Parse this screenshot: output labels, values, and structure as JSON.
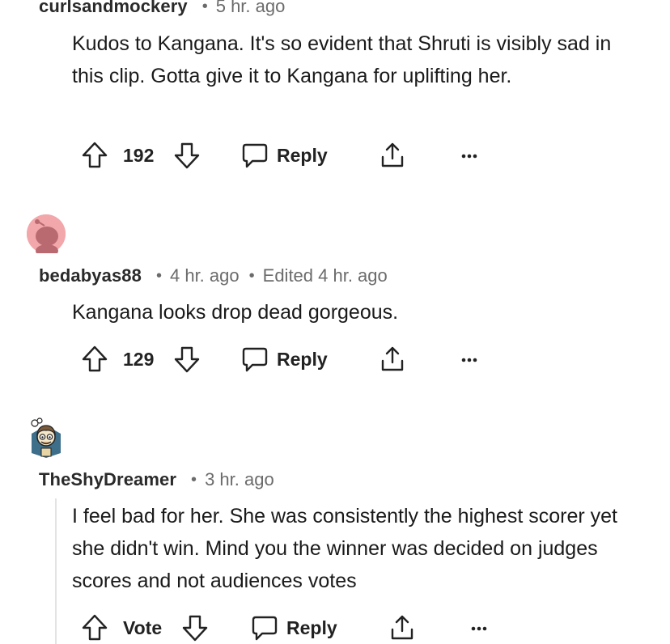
{
  "comments": [
    {
      "author": "curlsandmockery",
      "time": "5 hr. ago",
      "body": "Kudos to Kangana. It's so evident that Shruti is visibly sad in this clip. Gotta give it to Kangana for uplifting her.",
      "votes": "192",
      "reply_label": "Reply"
    },
    {
      "author": "bedabyas88",
      "time": "4 hr. ago",
      "edited": "Edited 4 hr. ago",
      "body": "Kangana looks drop dead gorgeous.",
      "votes": "129",
      "reply_label": "Reply"
    },
    {
      "author": "TheShyDreamer",
      "time": "3 hr. ago",
      "body": "I feel bad for her. She was consistently the highest scorer yet she didn't win. Mind you the winner was decided on judges scores and not audiences votes",
      "votes": "Vote",
      "reply_label": "Reply"
    }
  ],
  "separator": "•",
  "icons": {
    "upvote": "upvote-arrow-icon",
    "downvote": "downvote-arrow-icon",
    "reply": "speech-bubble-icon",
    "share": "share-icon",
    "more": "more-dots-icon"
  },
  "colors": {
    "avatar_pink": "#f2a7ab",
    "meta_gray": "#6b6b6b",
    "thread_line": "#e3e3e3"
  }
}
